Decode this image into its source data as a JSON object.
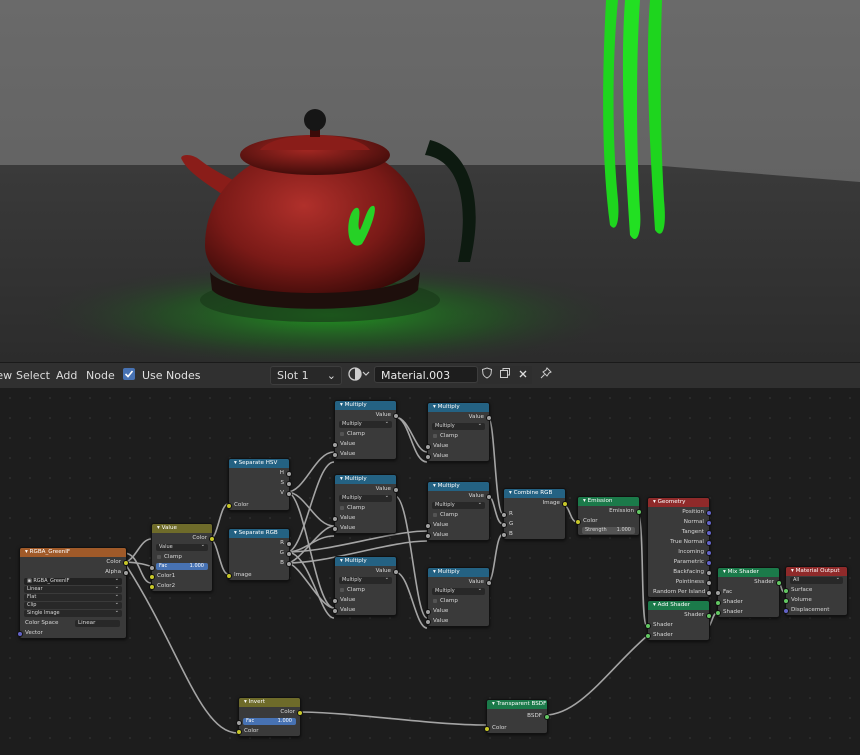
{
  "toolbar": {
    "menu_view": "View",
    "menu_select": "Select",
    "menu_add": "Add",
    "menu_node": "Node",
    "use_nodes_label": "Use Nodes",
    "slot": "Slot 1",
    "material_name": "Material.003"
  },
  "colors": {
    "socket_float": "#a1a1a1",
    "socket_color": "#c7c729",
    "socket_shader": "#63c763",
    "socket_vector": "#6363c7",
    "header_converter": "#246283",
    "header_input": "#6e6b2a",
    "header_texture": "#a05a29",
    "header_shader": "#1b7a4a",
    "header_output": "#8f2a2a",
    "accent_blue": "#4772b3",
    "emission_green": "#1fd11f"
  },
  "nodes": {
    "rgba": {
      "title": "RGBA_GreenIF",
      "out_color": "Color",
      "out_alpha": "Alpha",
      "image_name": "RGBA_GreenIF",
      "interp": "Linear",
      "projection": "Flat",
      "extension": "Clip",
      "source": "Single Image",
      "colorspace_label": "Color Space",
      "colorspace": "Linear",
      "in_vector": "Vector"
    },
    "value": {
      "title": "Value",
      "out_color": "Color",
      "blend": "Value",
      "clamp": "Clamp",
      "fac_label": "Fac",
      "fac_value": "1.000",
      "in_color1": "Color1",
      "in_color2": "Color2"
    },
    "sephsv": {
      "title": "Separate HSV",
      "out_h": "H",
      "out_s": "S",
      "out_v": "V",
      "in_color": "Color"
    },
    "seprgb": {
      "title": "Separate RGB",
      "out_r": "R",
      "out_g": "G",
      "out_b": "B",
      "in_image": "Image"
    },
    "multiply": {
      "title": "Multiply",
      "out_value": "Value",
      "op": "Multiply",
      "clamp": "Clamp",
      "in_value": "Value"
    },
    "combine": {
      "title": "Combine RGB",
      "out_image": "Image",
      "in_r": "R",
      "in_g": "G",
      "in_b": "B"
    },
    "emission": {
      "title": "Emission",
      "out": "Emission",
      "in_color": "Color",
      "strength_label": "Strength",
      "strength": "1.000"
    },
    "geometry": {
      "title": "Geometry",
      "outputs": [
        "Position",
        "Normal",
        "Tangent",
        "True Normal",
        "Incoming",
        "Parametric",
        "Backfacing",
        "Pointiness",
        "Random Per Island"
      ]
    },
    "mix": {
      "title": "Mix Shader",
      "out": "Shader",
      "in_fac": "Fac",
      "in_shader": "Shader"
    },
    "add": {
      "title": "Add Shader",
      "out": "Shader",
      "in_shader": "Shader"
    },
    "output": {
      "title": "Material Output",
      "target": "All",
      "in_surface": "Surface",
      "in_volume": "Volume",
      "in_displacement": "Displacement"
    },
    "invert": {
      "title": "Invert",
      "out_color": "Color",
      "fac_label": "Fac",
      "fac_value": "1.000",
      "in_color": "Color"
    },
    "transparent": {
      "title": "Transparent BSDF",
      "out": "BSDF",
      "in_color": "Color"
    }
  }
}
